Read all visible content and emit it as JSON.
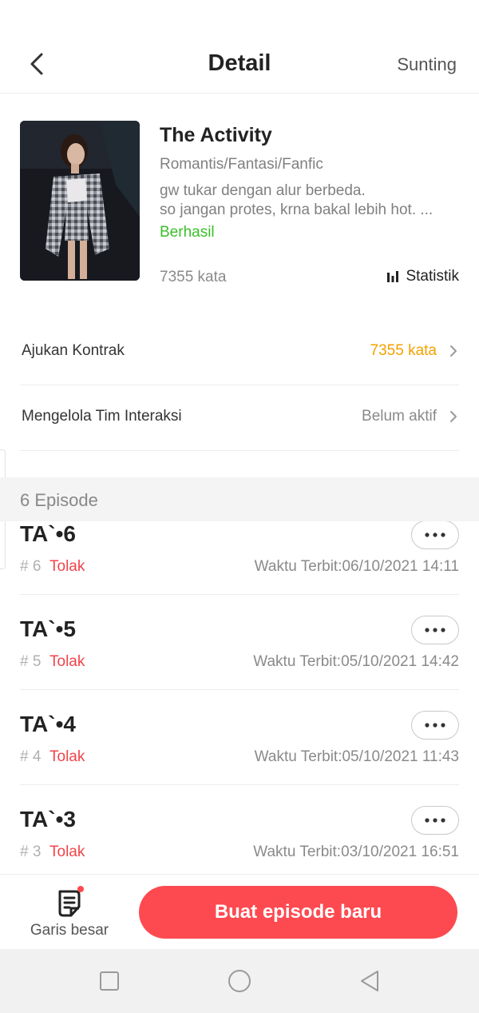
{
  "header": {
    "title": "Detail",
    "edit_label": "Sunting",
    "back_icon": "chevron-left-icon"
  },
  "book": {
    "title": "The Activity",
    "genre": "Romantis/Fantasi/Fanfic",
    "description_lines": [
      "gw tukar dengan alur berbeda.",
      "so jangan protes, krna bakal lebih hot. ..."
    ],
    "status": "Berhasil",
    "status_color": "#3bbf2a",
    "word_count": "7355 kata",
    "stats_label": "Statistik",
    "stats_icon": "bar-chart-icon"
  },
  "menu": [
    {
      "label": "Ajukan Kontrak",
      "value": "7355 kata",
      "value_color": "#f5a100"
    },
    {
      "label": "Mengelola Tim Interaksi",
      "value": "Belum aktif",
      "value_color": "#8a8a8a"
    }
  ],
  "episodes_section": {
    "label": "6 Episode"
  },
  "episodes": [
    {
      "title": "TA`•6",
      "number": "# 6",
      "status": "Tolak",
      "publish_time": "Waktu Terbit:06/10/2021 14:11"
    },
    {
      "title": "TA`•5",
      "number": "# 5",
      "status": "Tolak",
      "publish_time": "Waktu Terbit:05/10/2021 14:42"
    },
    {
      "title": "TA`•4",
      "number": "# 4",
      "status": "Tolak",
      "publish_time": "Waktu Terbit:05/10/2021 11:43"
    },
    {
      "title": "TA`•3",
      "number": "# 3",
      "status": "Tolak",
      "publish_time": "Waktu Terbit:03/10/2021 16:51"
    }
  ],
  "bottom": {
    "outline_label": "Garis besar",
    "outline_icon": "outline-document-icon",
    "create_label": "Buat episode baru"
  },
  "colors": {
    "accent": "#fd4a50",
    "rejected": "#f0444a"
  }
}
